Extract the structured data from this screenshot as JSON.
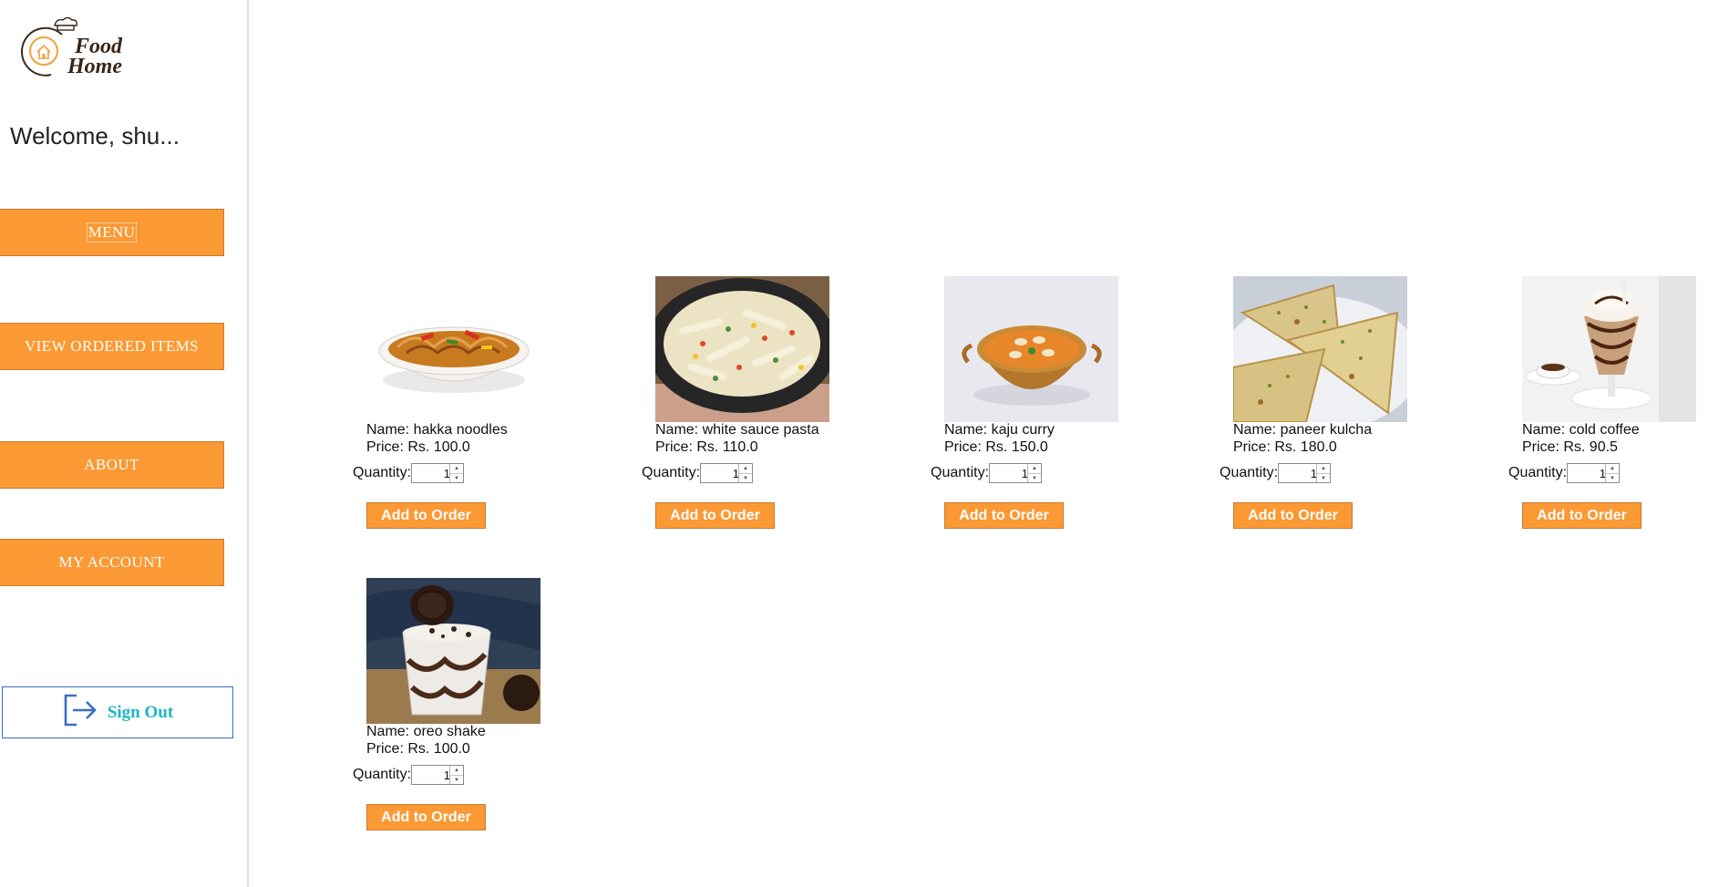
{
  "brand": {
    "line1": "Food",
    "line2": "Home"
  },
  "welcome": "Welcome, shu...",
  "nav": {
    "menu": "MENU",
    "ordered": "VIEW ORDERED ITEMS",
    "about": "ABOUT",
    "account": "MY ACCOUNT"
  },
  "signout": {
    "label": "Sign Out",
    "icon": "sign-out-icon"
  },
  "qty_label": "Quantity:",
  "add_label": "Add to Order",
  "items": [
    {
      "name": "Name: hakka noodles",
      "price": "Price: Rs. 100.0",
      "qty": "1",
      "image": "noodles-image"
    },
    {
      "name": "Name: white sauce pasta",
      "price": "Price: Rs. 110.0",
      "qty": "1",
      "image": "pasta-image"
    },
    {
      "name": "Name: kaju curry",
      "price": "Price: Rs. 150.0",
      "qty": "1",
      "image": "curry-image"
    },
    {
      "name": "Name: paneer kulcha",
      "price": "Price: Rs. 180.0",
      "qty": "1",
      "image": "kulcha-image"
    },
    {
      "name": "Name: cold coffee",
      "price": "Price: Rs. 90.5",
      "qty": "1",
      "image": "coffee-image"
    },
    {
      "name": "Name: oreo shake",
      "price": "Price: Rs. 100.0",
      "qty": "1",
      "image": "shake-image"
    }
  ],
  "colors": {
    "accent": "#fb9935",
    "signout_text": "#1cb6c4",
    "signout_border": "#3a6fc4"
  }
}
